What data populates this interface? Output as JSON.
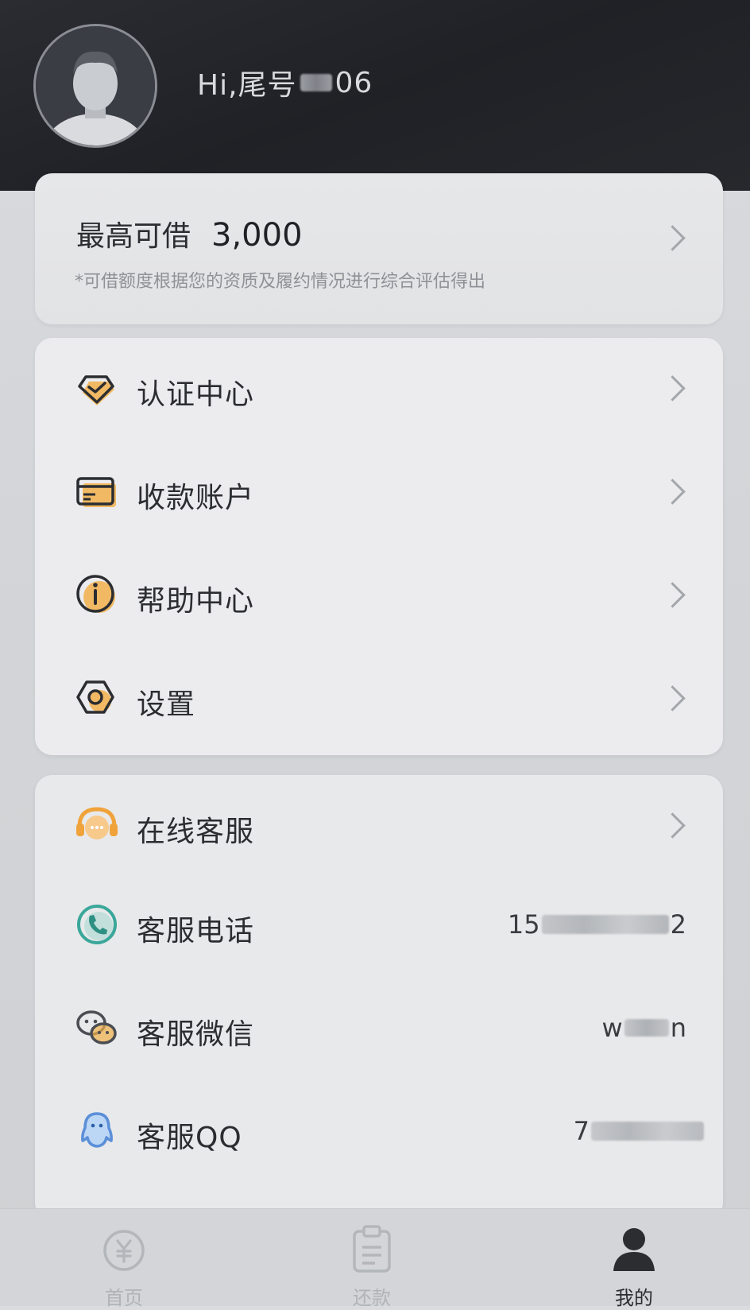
{
  "header": {
    "greeting": "Hi,尾号",
    "phone_tail": "06"
  },
  "limit_card": {
    "label": "最高可借",
    "amount": "3,000",
    "note": "*可借额度根据您的资质及履约情况进行综合评估得出"
  },
  "menu": {
    "items": [
      {
        "label": "认证中心",
        "icon": "verified-diamond-icon"
      },
      {
        "label": "收款账户",
        "icon": "card-icon"
      },
      {
        "label": "帮助中心",
        "icon": "info-icon"
      },
      {
        "label": "设置",
        "icon": "settings-hexagon-icon"
      }
    ]
  },
  "service": {
    "online": {
      "label": "在线客服",
      "icon": "headset-icon"
    },
    "phone": {
      "label": "客服电话",
      "value_prefix": "15",
      "value_suffix": "2",
      "icon": "phone-icon"
    },
    "wechat": {
      "label": "客服微信",
      "value_prefix": "w",
      "value_suffix": "n",
      "icon": "wechat-icon"
    },
    "qq": {
      "label": "客服QQ",
      "value_prefix": "7",
      "value_suffix": "",
      "icon": "qq-icon"
    }
  },
  "tabbar": {
    "tabs": [
      {
        "label": "首页",
        "icon": "yuan-coin-icon",
        "active": false
      },
      {
        "label": "还款",
        "icon": "clipboard-icon",
        "active": false
      },
      {
        "label": "我的",
        "icon": "user-icon",
        "active": true
      }
    ]
  },
  "colors": {
    "accent": "#f0a33a",
    "header_bg": "#222429",
    "text_primary": "#2b2d31",
    "text_muted": "#8e9196"
  }
}
